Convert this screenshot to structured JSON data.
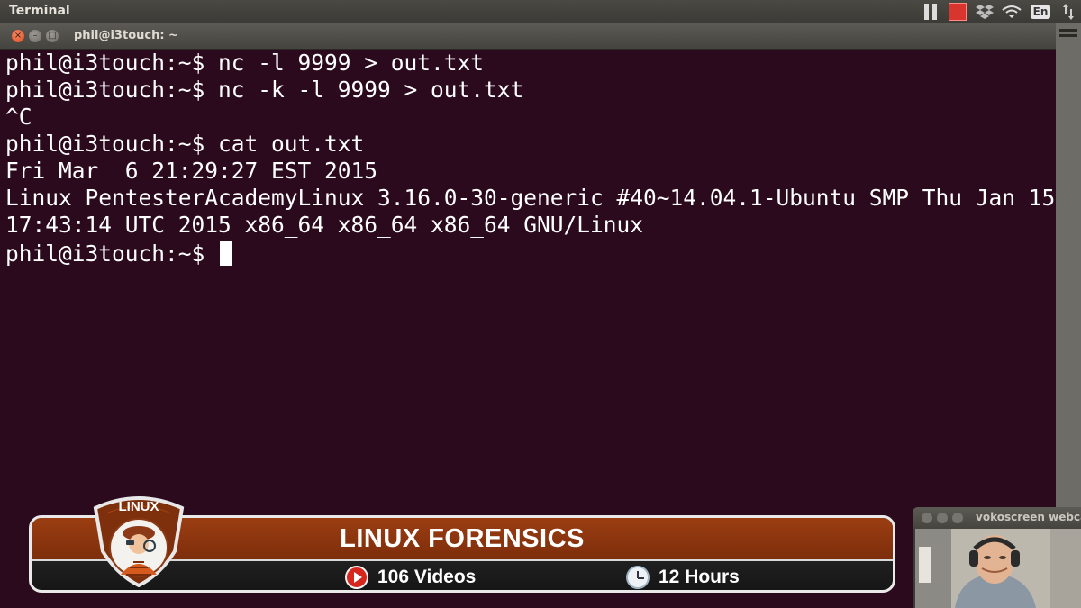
{
  "top_panel": {
    "app_title": "Terminal",
    "tray": {
      "pause_icon": "pause-icon",
      "record_icon": "record-stop-icon",
      "dropbox_icon": "dropbox-icon",
      "wifi_icon": "wifi-icon",
      "language": "En"
    }
  },
  "window": {
    "title": "phil@i3touch: ~",
    "close_glyph": "×",
    "minimize_glyph": "–",
    "maximize_glyph": "□"
  },
  "terminal": {
    "lines": [
      "phil@i3touch:~$ nc -l 9999 > out.txt",
      "phil@i3touch:~$ nc -k -l 9999 > out.txt",
      "^C",
      "phil@i3touch:~$ cat out.txt",
      "Fri Mar  6 21:29:27 EST 2015",
      "Linux PentesterAcademyLinux 3.16.0-30-generic #40~14.04.1-Ubuntu SMP Thu Jan 15",
      "17:43:14 UTC 2015 x86_64 x86_64 x86_64 GNU/Linux",
      "phil@i3touch:~$ "
    ],
    "colors": {
      "background": "#2c0a1e",
      "foreground": "#ffffff"
    }
  },
  "banner": {
    "badge_label": "LINUX",
    "title": "LINUX FORENSICS",
    "videos": "106 Videos",
    "hours": "12 Hours",
    "accent_color": "#8b3510"
  },
  "webcam": {
    "title": "vokoscreen webcam"
  }
}
